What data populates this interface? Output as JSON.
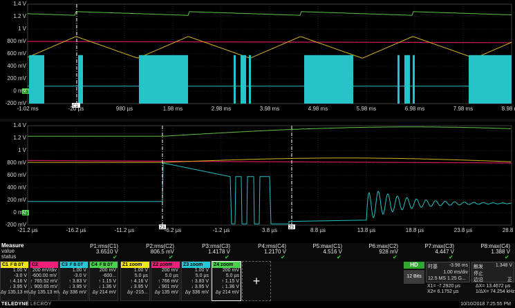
{
  "colors": {
    "c1": "#f2e51a",
    "c2": "#ee1f7a",
    "c3": "#23c9d6",
    "c4": "#4ad24a",
    "z1": "#f2e51a",
    "z2": "#ee1f7a",
    "z3": "#23c9d6",
    "z4": "#4ad24a",
    "grid": "#3a3a3a",
    "trace_c3": "#26c3c8",
    "trace_c2": "#d2185b",
    "trace_c1": "#d8b21c",
    "trace_c4": "#62c44a",
    "ok": "#2fd12f",
    "hd": "#2ea82e"
  },
  "top_panel": {
    "y_ticks": [
      "1.4 V",
      "1.2 V",
      "1 V",
      "800 mV",
      "600 mV",
      "400 mV",
      "200 mV",
      "0 mV",
      "-200 mV"
    ],
    "x_ticks": [
      "-1.02 ms",
      "-20 µs",
      "980 µs",
      "1.98 ms",
      "2.98 ms",
      "3.98 ms",
      "4.98 ms",
      "5.98 ms",
      "6.98 ms",
      "7.98 ms",
      "8.98 ms"
    ],
    "ground_marker": "C3",
    "cursor_marker": "C1"
  },
  "bottom_panel": {
    "y_ticks": [
      "1.4 V",
      "1.2 V",
      "1 V",
      "800 mV",
      "600 mV",
      "400 mV",
      "200 mV",
      "0 mV",
      "-200 mV"
    ],
    "x_ticks": [
      "-21.2 µs",
      "-16.2 µs",
      "-11.2 µs",
      "-6.2 µs",
      "-1.2 µs",
      "3.8 µs",
      "8.8 µs",
      "13.8 µs",
      "18.8 µs",
      "23.8 µs",
      "28.8 µs"
    ],
    "ground_marker": "Z3",
    "cursor_markers": [
      "Z3",
      "Z3"
    ]
  },
  "measure": {
    "title": "Measure",
    "value_label": "value",
    "status_label": "status",
    "columns": [
      {
        "name": "P1:rms(C1)",
        "value": "3.6510 V"
      },
      {
        "name": "P2:rms(C2)",
        "value": "806.5 mV"
      },
      {
        "name": "P3:rms(C3)",
        "value": "1.4178 V"
      },
      {
        "name": "P4:rms(C4)",
        "value": "1.2170 V"
      },
      {
        "name": "P5:max(C1)",
        "value": "4.516 V"
      },
      {
        "name": "P6:max(C2)",
        "value": "928 mV"
      },
      {
        "name": "P7:max(C3)",
        "value": "4.447 V"
      },
      {
        "name": "P8:max(C4)",
        "value": "1.388 V"
      }
    ]
  },
  "channels": [
    {
      "label": "C1",
      "tags": "F B DT",
      "rows": [
        "1.00 V",
        "-3.0 V",
        "↑ 4.16 V",
        "↓ 3.95 V",
        "Δy 135.13 mV"
      ]
    },
    {
      "label": "C2",
      "tags": "",
      "rows": [
        "200 mV/div",
        "-600.00 mV",
        "↑ 765.52 mV",
        "↓ 900.65 mV",
        "Δy 135.13 mV"
      ]
    },
    {
      "label": "C3",
      "tags": "F B DT",
      "rows": [
        "1.00 V",
        "-3.0 V",
        "↑ 3.83 V",
        "↓ 3.95 V",
        "Δy 336 mV"
      ]
    },
    {
      "label": "C4",
      "tags": "F B DT",
      "rows": [
        "200 mV",
        "-600...",
        "↑ 1.15 V",
        "↓ 1.36 V",
        "Δy 214 mV"
      ]
    }
  ],
  "zooms": [
    {
      "label": "Z1 zoom",
      "rows": [
        "1.00 V",
        "5.0 µs",
        "↑ 4.16 V",
        "↓ 3.95 V",
        "Δy -215..."
      ]
    },
    {
      "label": "Z2 zoom",
      "rows": [
        "200 mV",
        "5.0 µs",
        "↑ 766 mV",
        "↓ 901 mV",
        "Δy 135 mV"
      ]
    },
    {
      "label": "Z3 zoom",
      "rows": [
        "1.00 V",
        "5.0 µs",
        "↑ 3.83 V",
        "↓ 3.95 V",
        "Δy 336 mV"
      ]
    },
    {
      "label": "Z4 zoom",
      "rows": [
        "200 mV",
        "5.0 µs",
        "↑ 1.15 V",
        "↓ 1.36 V",
        "Δy 214 mV"
      ]
    }
  ],
  "add_label": "+",
  "timebase": {
    "hd": "HD",
    "bits": "12 Bits",
    "timebase_label": "时基",
    "timebase_value": "-3.98 ms",
    "timebase_scale": "1.00 ms/div",
    "sample": "12.5 MS 1.25 G...",
    "trigger_label": "触发",
    "trigger_value": "1.348 V",
    "trigger_mode": "停止",
    "trigger_edge": "边沿",
    "trigger_slope": "正",
    "x1": "X1= -7.2920 µs",
    "dx": "ΔX= 13.4672 µs",
    "x2": "X2= 6.1752 µs",
    "inv_dx": "1/ΔX= 74.254 kHz"
  },
  "footer": {
    "brand": "TELEDYNE",
    "brand_sub": "LECROY",
    "datetime": "10/10/2018 7:25:55 PM"
  }
}
